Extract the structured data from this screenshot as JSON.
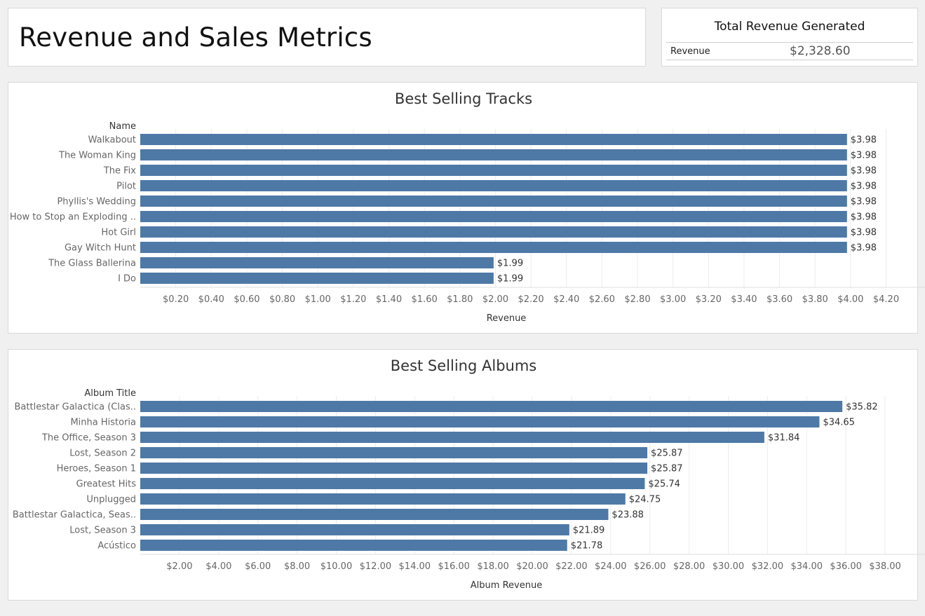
{
  "header": {
    "title": "Revenue and Sales Metrics"
  },
  "kpi": {
    "title": "Total Revenue Generated",
    "label": "Revenue",
    "value": "$2,328.60"
  },
  "colors": {
    "bar": "#4e79a7"
  },
  "chart_data": [
    {
      "type": "bar",
      "orientation": "horizontal",
      "title": "Best Selling Tracks",
      "category_header": "Name",
      "xlabel": "Revenue",
      "categories": [
        "Walkabout",
        "The Woman King",
        "The Fix",
        "Pilot",
        "Phyllis's Wedding",
        "How to Stop an Exploding ..",
        "Hot Girl",
        "Gay Witch Hunt",
        "The Glass Ballerina",
        "I Do"
      ],
      "values": [
        3.98,
        3.98,
        3.98,
        3.98,
        3.98,
        3.98,
        3.98,
        3.98,
        1.99,
        1.99
      ],
      "value_labels": [
        "$3.98",
        "$3.98",
        "$3.98",
        "$3.98",
        "$3.98",
        "$3.98",
        "$3.98",
        "$3.98",
        "$1.99",
        "$1.99"
      ],
      "xlim": [
        0,
        4.36
      ],
      "ticks": [
        0.2,
        0.4,
        0.6,
        0.8,
        1.0,
        1.2,
        1.4,
        1.6,
        1.8,
        2.0,
        2.2,
        2.4,
        2.6,
        2.8,
        3.0,
        3.2,
        3.4,
        3.6,
        3.8,
        4.0,
        4.2
      ],
      "tick_labels": [
        "$0.20",
        "$0.40",
        "$0.60",
        "$0.80",
        "$1.00",
        "$1.20",
        "$1.40",
        "$1.60",
        "$1.80",
        "$2.00",
        "$2.20",
        "$2.40",
        "$2.60",
        "$2.80",
        "$3.00",
        "$3.20",
        "$3.40",
        "$3.60",
        "$3.80",
        "$4.00",
        "$4.20"
      ],
      "grid": true
    },
    {
      "type": "bar",
      "orientation": "horizontal",
      "title": "Best Selling Albums",
      "category_header": "Album Title",
      "xlabel": "Album Revenue",
      "categories": [
        "Battlestar Galactica (Clas..",
        "Minha Historia",
        "The Office, Season 3",
        "Lost, Season 2",
        "Heroes, Season 1",
        "Greatest Hits",
        "Unplugged",
        "Battlestar Galactica, Seas..",
        "Lost, Season 3",
        "Acústico"
      ],
      "values": [
        35.82,
        34.65,
        31.84,
        25.87,
        25.87,
        25.74,
        24.75,
        23.88,
        21.89,
        21.78
      ],
      "value_labels": [
        "$35.82",
        "$34.65",
        "$31.84",
        "$25.87",
        "$25.87",
        "$25.74",
        "$24.75",
        "$23.88",
        "$21.89",
        "$21.78"
      ],
      "xlim": [
        0,
        39.5
      ],
      "ticks": [
        2,
        4,
        6,
        8,
        10,
        12,
        14,
        16,
        18,
        20,
        22,
        24,
        26,
        28,
        30,
        32,
        34,
        36,
        38
      ],
      "tick_labels": [
        "$2.00",
        "$4.00",
        "$6.00",
        "$8.00",
        "$10.00",
        "$12.00",
        "$14.00",
        "$16.00",
        "$18.00",
        "$20.00",
        "$22.00",
        "$24.00",
        "$26.00",
        "$28.00",
        "$30.00",
        "$32.00",
        "$34.00",
        "$36.00",
        "$38.00"
      ],
      "grid": true
    }
  ]
}
